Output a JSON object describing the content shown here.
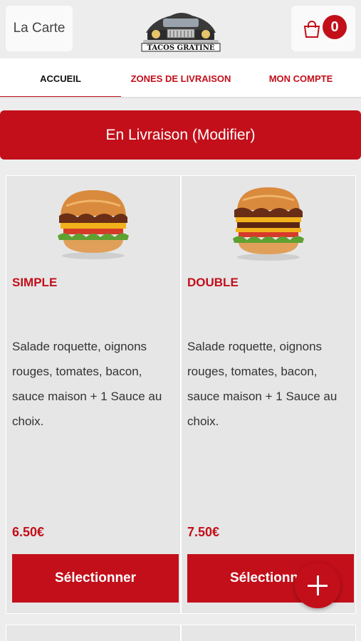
{
  "header": {
    "menu_label": "La Carte",
    "logo_text": "TACOS GRATINÉ",
    "cart_count": "0"
  },
  "tabs": [
    {
      "label": "ACCUEIL"
    },
    {
      "label": "ZONES DE LIVRAISON"
    },
    {
      "label": "MON COMPTE"
    }
  ],
  "delivery_banner": "En Livraison (Modifier)",
  "products": [
    {
      "name": "SIMPLE",
      "description": "Salade roquette, oignons rouges, tomates, bacon, sauce maison + 1 Sauce au choix.",
      "price": "6.50€",
      "button": "Sélectionner"
    },
    {
      "name": "DOUBLE",
      "description": "Salade roquette, oignons rouges, tomates, bacon, sauce maison + 1 Sauce au choix.",
      "price": "7.50€",
      "button": "Sélectionner"
    }
  ],
  "colors": {
    "accent": "#c20f1a",
    "background": "#ededed"
  }
}
